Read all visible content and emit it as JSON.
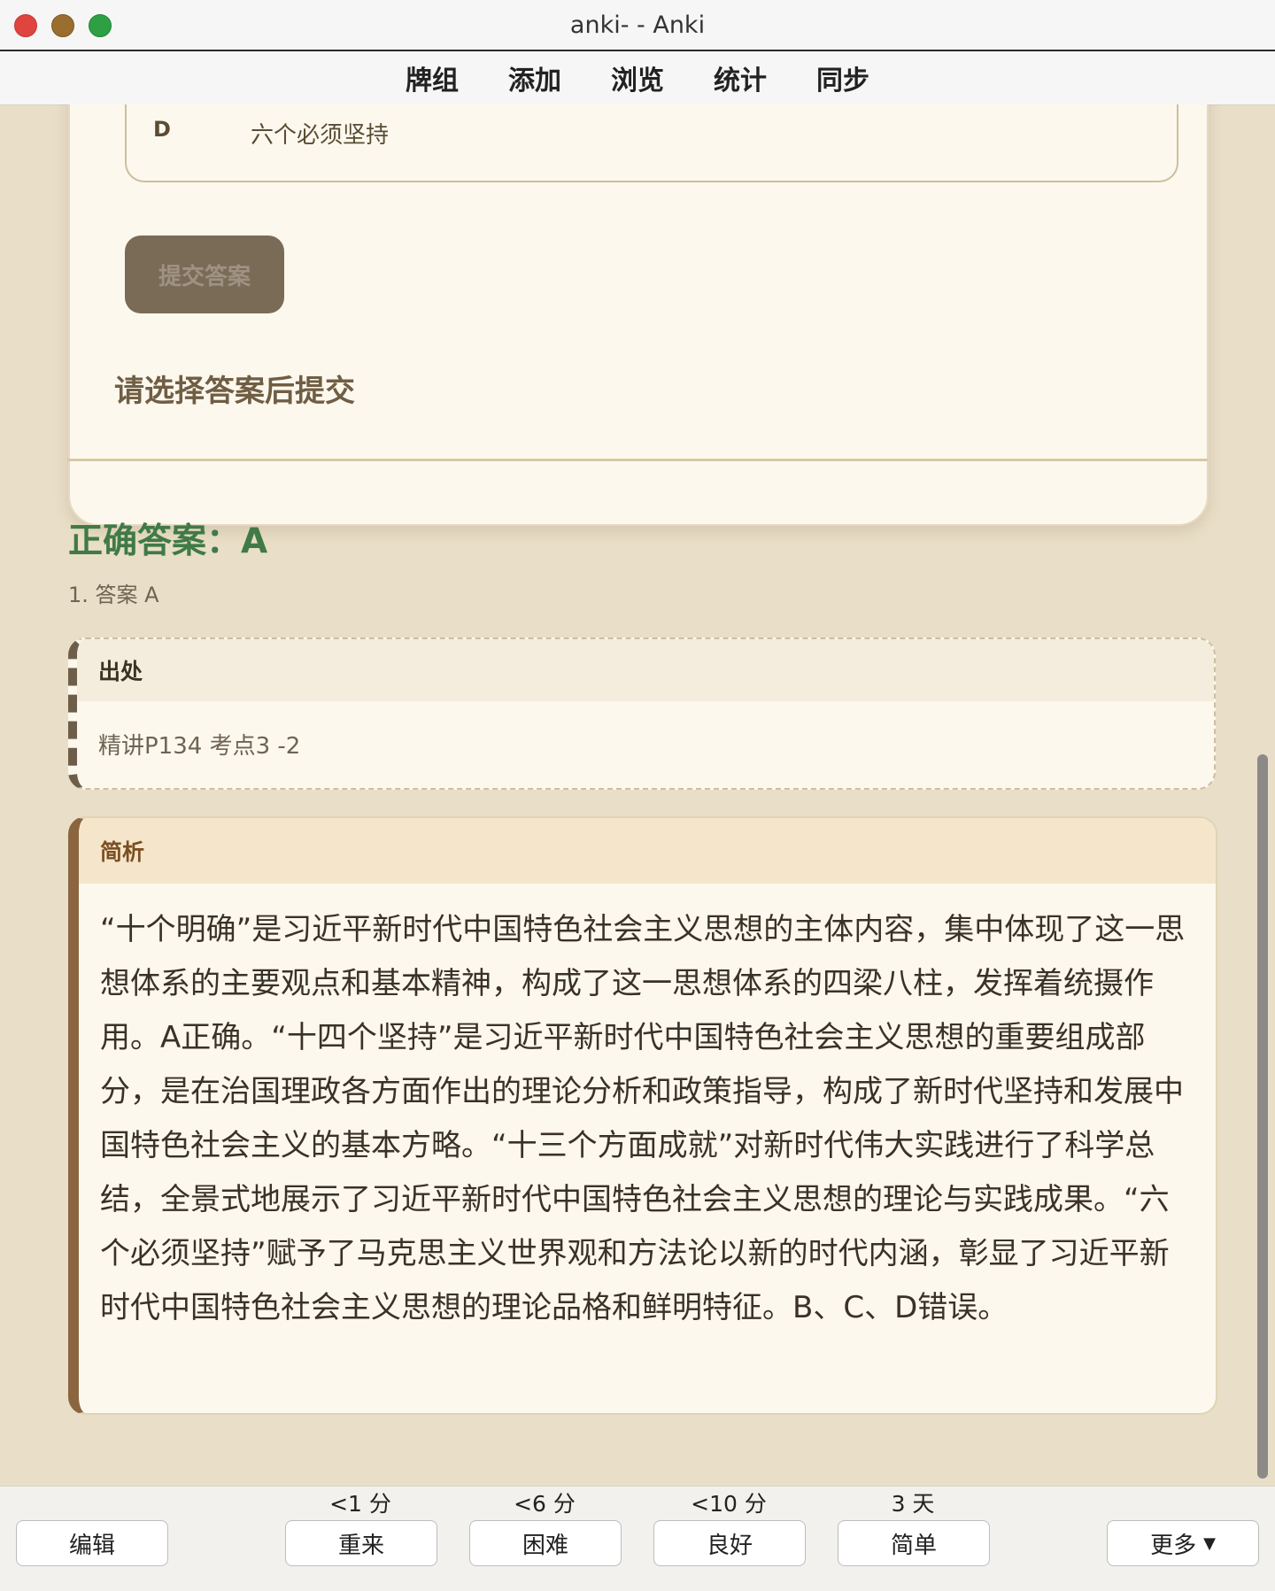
{
  "window": {
    "title": "anki- - Anki"
  },
  "menu": {
    "items": [
      "牌组",
      "添加",
      "浏览",
      "统计",
      "同步"
    ]
  },
  "question": {
    "option_letter": "D",
    "option_text": "六个必须坚持",
    "submit_label": "提交答案",
    "hint": "请选择答案后提交"
  },
  "answer": {
    "title": "正确答案：A",
    "list_item": "1. 答案 A",
    "source_label": "出处",
    "source_text": "精讲P134 考点3 -2",
    "analysis_label": "简析",
    "analysis_text": "“十个明确”是习近平新时代中国特色社会主义思想的主体内容，集中体现了这一思想体系的主要观点和基本精神，构成了这一思想体系的四梁八柱，发挥着统摄作用。A正确。“十四个坚持”是习近平新时代中国特色社会主义思想的重要组成部分，是在治国理政各方面作出的理论分析和政策指导，构成了新时代坚持和发展中国特色社会主义的基本方略。“十三个方面成就”对新时代伟大实践进行了科学总结，全景式地展示了习近平新时代中国特色社会主义思想的理论与实践成果。“六个必须坚持”赋予了马克思主义世界观和方法论以新的时代内涵，彰显了习近平新时代中国特色社会主义思想的理论品格和鲜明特征。B、C、D错误。"
  },
  "bottom": {
    "edit_label": "编辑",
    "again_label": "重来",
    "again_interval": "<1 分",
    "hard_label": "困难",
    "hard_interval": "<6 分",
    "good_label": "良好",
    "good_interval": "<10 分",
    "easy_label": "简单",
    "easy_interval": "3 天",
    "more_label": "更多"
  },
  "colors": {
    "correct": "#3f7a47",
    "accent": "#8b6540",
    "background": "#e9dec7"
  }
}
